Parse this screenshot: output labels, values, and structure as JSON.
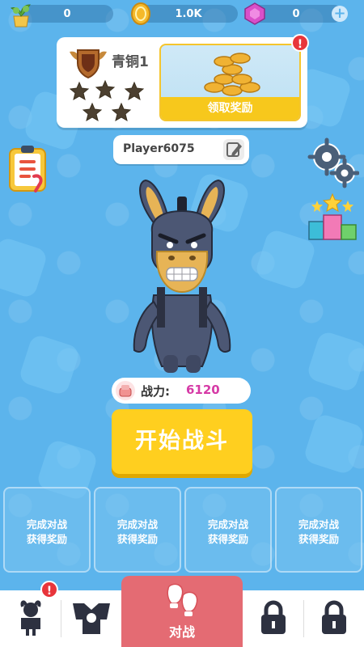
{
  "currency": {
    "plant_value": "0",
    "coins_value": "1.0K",
    "gems_value": "0"
  },
  "rank": {
    "title": "青铜1",
    "stars_total": 5,
    "stars_filled": 0,
    "reward_label": "领取奖励",
    "reward_alert": "!"
  },
  "player": {
    "name": "Player6075"
  },
  "power": {
    "label": "战力:",
    "value": "6120"
  },
  "start_button": "开始战斗",
  "quests": [
    {
      "line1": "完成对战",
      "line2": "获得奖励"
    },
    {
      "line1": "完成对战",
      "line2": "获得奖励"
    },
    {
      "line1": "完成对战",
      "line2": "获得奖励"
    },
    {
      "line1": "完成对战",
      "line2": "获得奖励"
    }
  ],
  "nav": {
    "character_alert": "!",
    "battle_label": "对战"
  },
  "colors": {
    "background": "#5cb4ec",
    "start_button": "#ffcf1f",
    "battle_tab": "#e46b73",
    "power_value": "#d63aa6",
    "alert": "#e8353b"
  },
  "icons": {
    "currency": [
      "plant-icon",
      "coin-icon",
      "gem-icon",
      "plus-icon"
    ],
    "side": [
      "task-clipboard-icon",
      "settings-gears-icon",
      "leaderboard-icon"
    ],
    "nav": [
      "character-icon",
      "equipment-icon",
      "boxing-gloves-icon",
      "lock-icon",
      "lock-icon"
    ]
  }
}
